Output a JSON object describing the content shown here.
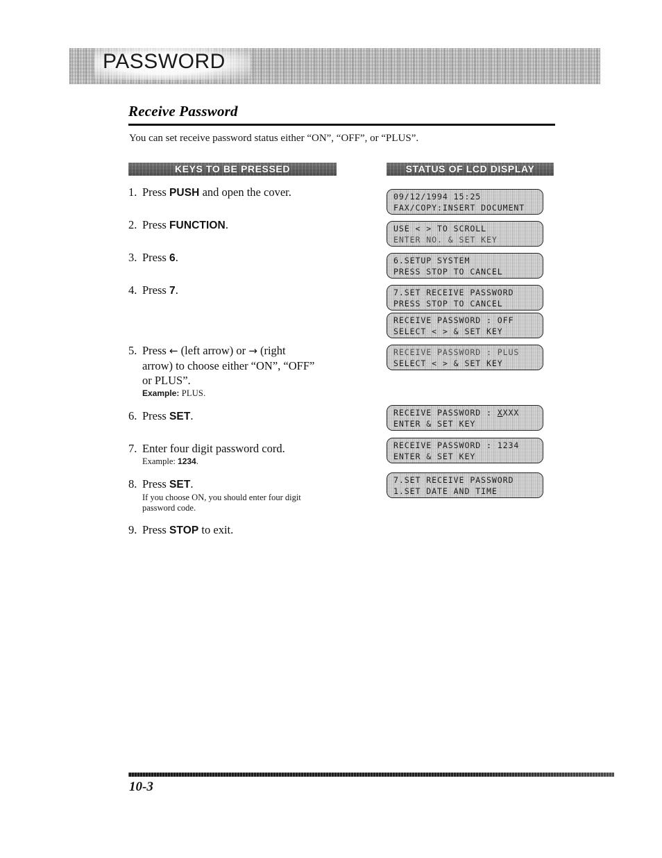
{
  "document": {
    "chapter_title": "PASSWORD",
    "section_heading": "Receive Password",
    "intro": "You can set receive password status either “ON”, “OFF”, or “PLUS”.",
    "page_number": "10-3"
  },
  "columns": {
    "keys_header": "KEYS TO BE PRESSED",
    "lcd_header": "STATUS OF LCD DISPLAY"
  },
  "steps": [
    {
      "number": "1.",
      "text_before": "Press ",
      "key": "PUSH",
      "text_after": " and open the cover.",
      "note": ""
    },
    {
      "number": "2.",
      "text_before": "Press ",
      "key": "FUNCTION",
      "text_after": ".",
      "note": ""
    },
    {
      "number": "3.",
      "text_before": "Press ",
      "key": "6",
      "text_after": ".",
      "note": ""
    },
    {
      "number": "4.",
      "text_before": "Press ",
      "key": "7",
      "text_after": ".",
      "note": ""
    },
    {
      "number": "5.",
      "line1_before": "Press ",
      "left_arrow": "←",
      "line1_mid": " (left arrow) or ",
      "right_arrow": "→",
      "line1_after": " (right",
      "line2": "arrow) to choose either “ON”, “OFF”",
      "line3": "or PLUS”.",
      "note_label": "Example: ",
      "note_value": "PLUS."
    },
    {
      "number": "6.",
      "text_before": "Press ",
      "key": "SET",
      "text_after": ".",
      "note": ""
    },
    {
      "number": "7.",
      "text_before": "Enter four digit password cord.",
      "key": "",
      "text_after": "",
      "note_label": "Example: ",
      "note_value": "1234",
      "note_tail": "."
    },
    {
      "number": "8.",
      "text_before": "Press ",
      "key": "SET",
      "text_after": ".",
      "note_line1": "If you choose ON, you should enter four digit",
      "note_line2": "password code."
    },
    {
      "number": "9.",
      "text_before": "Press ",
      "key": "STOP",
      "text_after": " to exit.",
      "note": ""
    }
  ],
  "lcd_panels": [
    {
      "line1": "09/12/1994 15:25",
      "line2": "FAX/COPY:INSERT DOCUMENT"
    },
    {
      "line1": "USE < > TO SCROLL",
      "line2": "ENTER NO. & SET KEY"
    },
    {
      "line1": "6.SETUP SYSTEM",
      "line2": "PRESS STOP TO CANCEL"
    },
    {
      "line1": "7.SET RECEIVE PASSWORD",
      "line2": "PRESS STOP TO CANCEL"
    },
    {
      "line1": "RECEIVE PASSWORD : OFF",
      "line2": "SELECT < > & SET KEY"
    },
    {
      "line1": "RECEIVE PASSWORD : PLUS",
      "line2": "SELECT < > & SET KEY"
    },
    {
      "line1_pre": "RECEIVE PASSWORD : ",
      "cursor": "X",
      "line1_post": "XXX",
      "line2": "ENTER & SET KEY"
    },
    {
      "line1": "RECEIVE PASSWORD : 1234",
      "line2": "ENTER & SET KEY"
    },
    {
      "line1": "7.SET RECEIVE PASSWORD",
      "line2": "1.SET DATE AND TIME"
    }
  ]
}
